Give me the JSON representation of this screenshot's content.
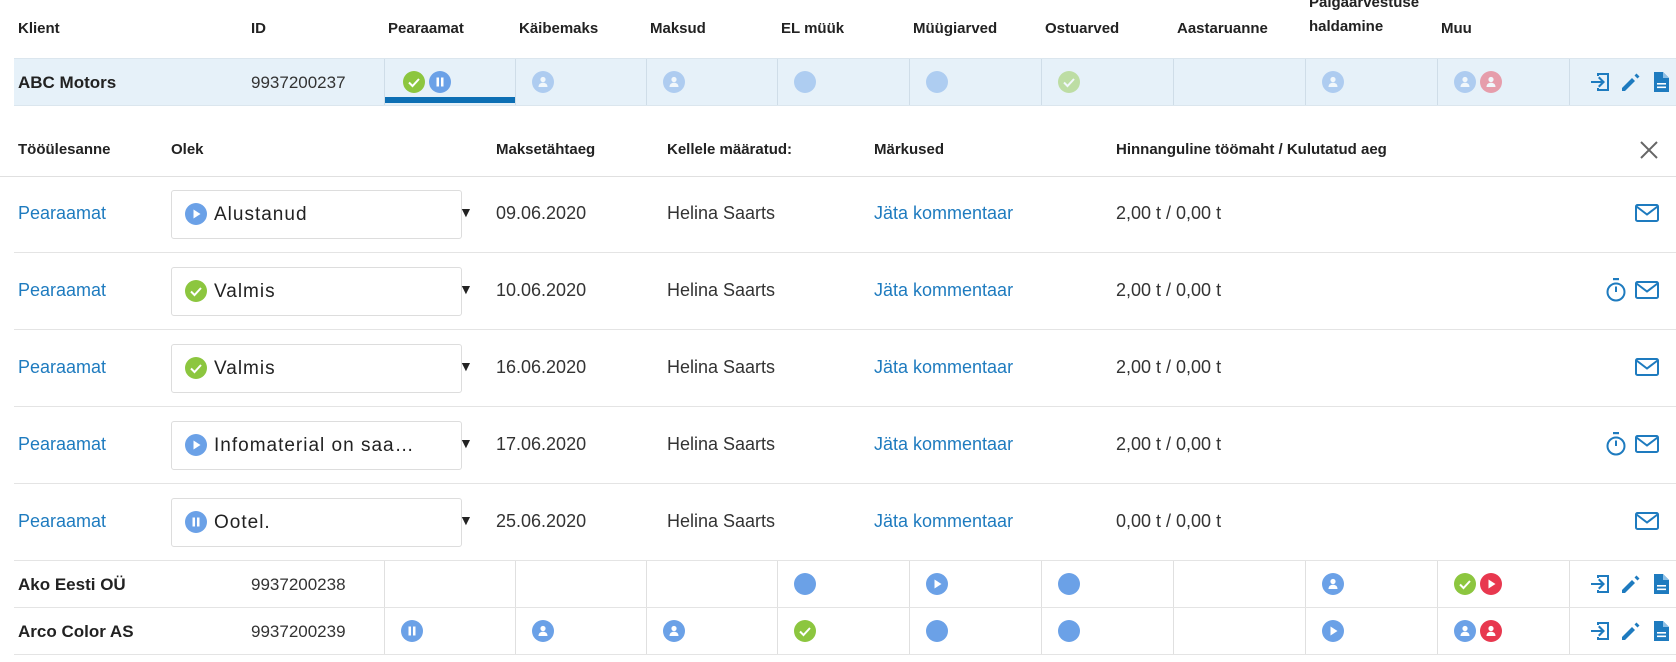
{
  "columns": {
    "klient": "Klient",
    "id": "ID",
    "pearaamat": "Pearaamat",
    "kaibemaks": "Käibemaks",
    "maksud": "Maksud",
    "el_muuk": "EL müük",
    "muugiarved": "Müügiarved",
    "ostuarved": "Ostuarved",
    "aastaruanne": "Aastaruanne",
    "palgaarvestus_line1": "Palgaarvestuse",
    "palgaarvestus_line2": "haldamine",
    "muu": "Muu"
  },
  "clients": [
    {
      "name": "ABC Motors",
      "id": "9937200237"
    },
    {
      "name": "Ako Eesti OÜ",
      "id": "9937200238"
    },
    {
      "name": "Arco Color AS",
      "id": "9937200239"
    }
  ],
  "task_table": {
    "headers": {
      "task": "Tööülesanne",
      "status": "Olek",
      "due": "Maksetähtaeg",
      "assigned": "Kellele määratud:",
      "notes": "Märkused",
      "estimate": "Hinnanguline töömaht / Kulutatud aeg"
    },
    "rows": [
      {
        "task": "Pearaamat",
        "status": "Alustanud",
        "status_icon": "play-icon",
        "due": "09.06.2020",
        "assigned": "Helina Saarts",
        "comment": "Jäta kommentaar",
        "hours": "2,00 t / 0,00 t"
      },
      {
        "task": "Pearaamat",
        "status": "Valmis",
        "status_icon": "check-icon",
        "due": "10.06.2020",
        "assigned": "Helina Saarts",
        "comment": "Jäta kommentaar",
        "hours": "2,00 t / 0,00 t"
      },
      {
        "task": "Pearaamat",
        "status": "Valmis",
        "status_icon": "check-icon",
        "due": "16.06.2020",
        "assigned": "Helina Saarts",
        "comment": "Jäta kommentaar",
        "hours": "2,00 t / 0,00 t"
      },
      {
        "task": "Pearaamat",
        "status": "Infomaterial on saabunud",
        "status_icon": "play-icon",
        "due": "17.06.2020",
        "assigned": "Helina Saarts",
        "comment": "Jäta kommentaar",
        "hours": "2,00 t / 0,00 t"
      },
      {
        "task": "Pearaamat",
        "status": "Ootel.",
        "status_icon": "pause-icon",
        "due": "25.06.2020",
        "assigned": "Helina Saarts",
        "comment": "Jäta kommentaar",
        "hours": "0,00 t / 0,00 t"
      }
    ]
  },
  "colors": {
    "accent_blue": "#1e7bbf",
    "status_blue": "#6ba1e7",
    "status_green": "#8cc63f",
    "status_red": "#e8384f",
    "selected_row_bg": "#e6f1f9"
  }
}
